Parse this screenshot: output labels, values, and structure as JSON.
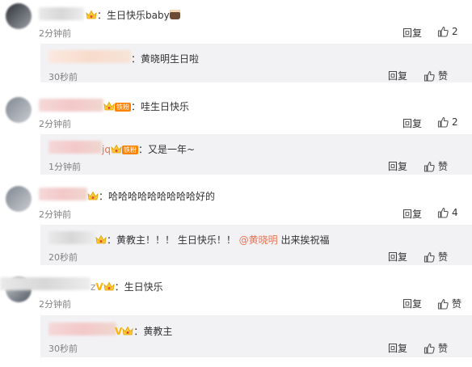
{
  "comments": [
    {
      "text": "生日快乐baby",
      "time": "2分钟前",
      "reply": "回复",
      "likes": "2",
      "sub": {
        "text": "黄晓明生日啦",
        "time": "30秒前",
        "reply": "回复",
        "likes": "赞"
      }
    },
    {
      "text": "哇生日快乐",
      "tag": "铁粉",
      "time": "2分钟前",
      "reply": "回复",
      "likes": "2",
      "sub": {
        "name_partial": "jq",
        "tag": "铁粉",
        "text": "又是一年~",
        "time": "1分钟前",
        "reply": "回复",
        "likes": "赞"
      }
    },
    {
      "text": "哈哈哈哈哈哈哈哈哈好的",
      "time": "2分钟前",
      "reply": "回复",
      "likes": "4",
      "sub": {
        "text_before": "黄教主！！！ 生日快乐！！",
        "mention": "@黄晓明",
        "text_after": "出来挨祝福",
        "time": "20秒前",
        "reply": "回复",
        "likes": "赞"
      }
    },
    {
      "name_partial": "z",
      "text": "生日快乐",
      "time": "2分钟前",
      "reply": "回复",
      "likes": "赞",
      "sub": {
        "text": "黄教主",
        "time": "30秒前",
        "reply": "回复",
        "likes": "赞"
      }
    }
  ],
  "colors": {
    "mention": "#eb7350",
    "badge": "#ffb400",
    "tag_bg": "#ff8200",
    "sub_bg": "#f2f2f5"
  },
  "icons": {
    "like": "thumb-up-icon",
    "badge": "vip-crown-icon",
    "verified": "v-badge-icon"
  }
}
